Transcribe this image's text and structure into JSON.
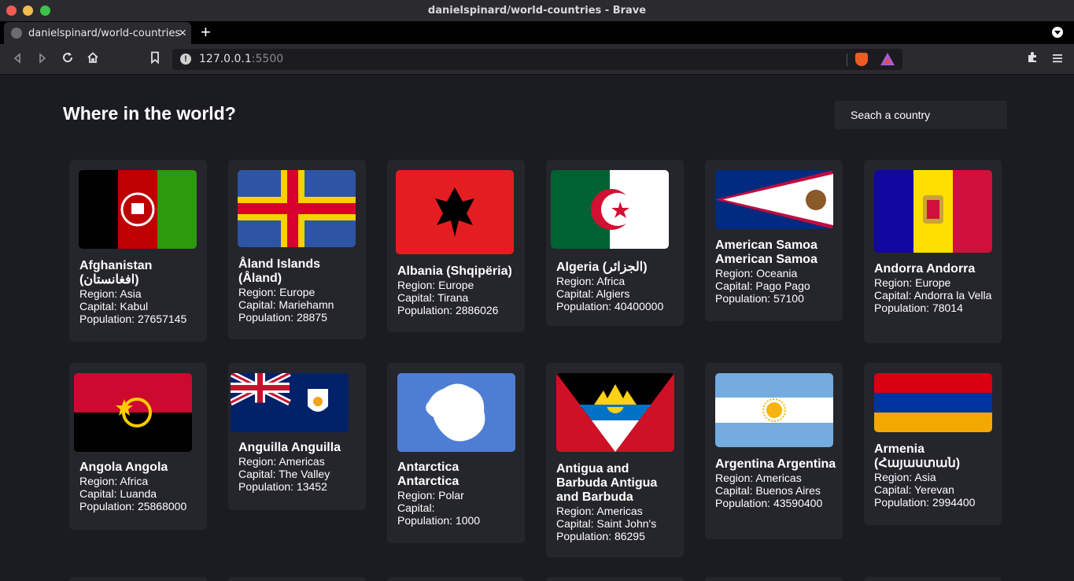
{
  "window": {
    "title": "danielspinard/world-countries - Brave"
  },
  "tab": {
    "title": "danielspinard/world-countries"
  },
  "toolbar": {
    "url_host": "127.0.0.1",
    "url_port": ":5500"
  },
  "header": {
    "title": "Where in the world?",
    "search_placeholder": "Seach a country"
  },
  "labels": {
    "region": "Region: ",
    "capital": "Capital: ",
    "population": "Population: "
  },
  "countries": [
    {
      "name": "Afghanistan (افغانستان)",
      "region": "Asia",
      "capital": "Kabul",
      "population": "27657145"
    },
    {
      "name": "Åland Islands (Åland)",
      "region": "Europe",
      "capital": "Mariehamn",
      "population": "28875"
    },
    {
      "name": "Albania (Shqipëria)",
      "region": "Europe",
      "capital": "Tirana",
      "population": "2886026"
    },
    {
      "name": "Algeria (الجزائر)",
      "region": "Africa",
      "capital": "Algiers",
      "population": "40400000"
    },
    {
      "name": "American Samoa American Samoa",
      "region": "Oceania",
      "capital": "Pago Pago",
      "population": "57100"
    },
    {
      "name": "Andorra Andorra",
      "region": "Europe",
      "capital": "Andorra la Vella",
      "population": "78014"
    },
    {
      "name": "Angola Angola",
      "region": "Africa",
      "capital": "Luanda",
      "population": "25868000"
    },
    {
      "name": "Anguilla Anguilla",
      "region": "Americas",
      "capital": "The Valley",
      "population": "13452"
    },
    {
      "name": "Antarctica Antarctica",
      "region": "Polar",
      "capital": "",
      "population": "1000"
    },
    {
      "name": "Antigua and Barbuda Antigua and Barbuda",
      "region": "Americas",
      "capital": "Saint John's",
      "population": "86295"
    },
    {
      "name": "Argentina Argentina",
      "region": "Americas",
      "capital": "Buenos Aires",
      "population": "43590400"
    },
    {
      "name": "Armenia (Հայաստան)",
      "region": "Asia",
      "capital": "Yerevan",
      "population": "2994400"
    }
  ]
}
